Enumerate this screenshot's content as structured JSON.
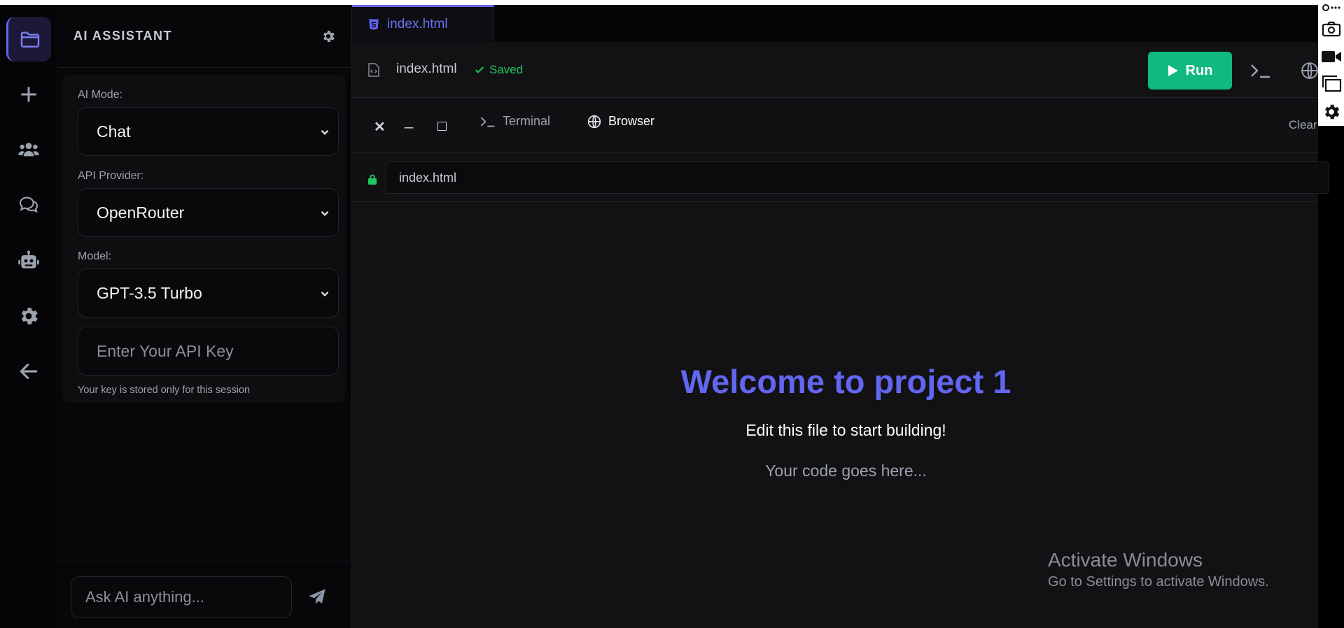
{
  "rail": {
    "items": [
      {
        "name": "files",
        "icon": "folder-icon"
      },
      {
        "name": "new",
        "icon": "plus-icon"
      },
      {
        "name": "team",
        "icon": "users-icon"
      },
      {
        "name": "chat",
        "icon": "comments-icon"
      },
      {
        "name": "ai",
        "icon": "robot-icon"
      },
      {
        "name": "settings",
        "icon": "gear-icon"
      },
      {
        "name": "back",
        "icon": "arrow-left-icon"
      }
    ]
  },
  "sidebar": {
    "title": "AI ASSISTANT",
    "ai_mode": {
      "label": "AI Mode:",
      "value": "Chat"
    },
    "provider": {
      "label": "API Provider:",
      "value": "OpenRouter"
    },
    "model": {
      "label": "Model:",
      "value": "GPT-3.5 Turbo"
    },
    "api_key": {
      "placeholder": "Enter Your API Key",
      "note": "Your key is stored only for this session"
    },
    "chat": {
      "placeholder": "Ask AI anything..."
    }
  },
  "editor": {
    "tab_label": "index.html",
    "filename": "index.html",
    "saved_label": "Saved",
    "run_label": "Run"
  },
  "panel": {
    "terminal_label": "Terminal",
    "browser_label": "Browser",
    "clear_label": "Clear",
    "url": "index.html"
  },
  "preview": {
    "title": "Welcome to project 1",
    "subtitle": "Edit this file to start building!",
    "code_note": "Your code goes here..."
  },
  "watermark": {
    "line1": "Activate Windows",
    "line2": "Go to Settings to activate Windows."
  },
  "colors": {
    "accent": "#6366f1",
    "run": "#10b981",
    "saved": "#22c55e",
    "background": "#121215"
  }
}
